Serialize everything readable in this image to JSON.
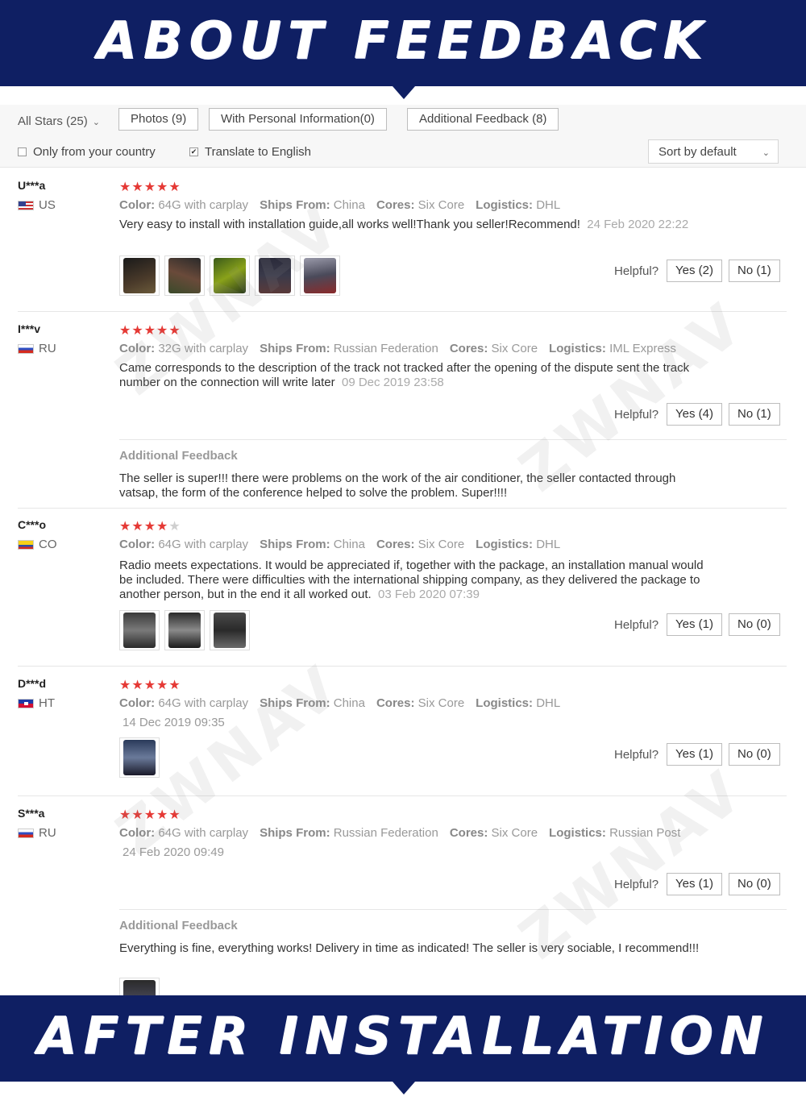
{
  "banners": {
    "top": "ABOUT FEEDBACK",
    "bottom": "AFTER INSTALLATION"
  },
  "filters": {
    "all_stars": "All Stars (25)",
    "photos": "Photos (9)",
    "personal_info": "With Personal Information(0)",
    "additional_feedback": "Additional Feedback (8)",
    "only_country": "Only from your country",
    "translate": "Translate to English",
    "translate_checked": true,
    "sort": "Sort by default"
  },
  "labels": {
    "color": "Color:",
    "ships_from": "Ships From:",
    "cores": "Cores:",
    "logistics": "Logistics:",
    "helpful": "Helpful?",
    "additional_feedback": "Additional Feedback"
  },
  "watermark": "ZWNAV",
  "reviews": [
    {
      "user": "U***a",
      "country": "US",
      "rating": 5,
      "color": "64G with carplay",
      "ships_from": "China",
      "cores": "Six Core",
      "logistics": "DHL",
      "text": "Very easy to install with installation guide,all works well!Thank you seller!Recommend!",
      "date": "24 Feb 2020 22:22",
      "yes": "Yes (2)",
      "no": "No (1)"
    },
    {
      "user": "I***v",
      "country": "RU",
      "rating": 5,
      "color": "32G with carplay",
      "ships_from": "Russian Federation",
      "cores": "Six Core",
      "logistics": "IML Express",
      "text": "Came corresponds to the description of the track not tracked after the opening of the dispute sent the track number on the connection will write later",
      "date": "09 Dec 2019 23:58",
      "yes": "Yes (4)",
      "no": "No (1)",
      "additional": "The seller is super!!! there were problems on the work of the air conditioner, the seller contacted through vatsap, the form of the conference helped to solve the problem. Super!!!!"
    },
    {
      "user": "C***o",
      "country": "CO",
      "rating": 4,
      "color": "64G with carplay",
      "ships_from": "China",
      "cores": "Six Core",
      "logistics": "DHL",
      "text": "Radio meets expectations. It would be appreciated if, together with the package, an installation manual would be included. There were difficulties with the international shipping company, as they delivered the package to another person, but in the end it all worked out.",
      "date": "03 Feb 2020 07:39",
      "yes": "Yes (1)",
      "no": "No (0)"
    },
    {
      "user": "D***d",
      "country": "HT",
      "rating": 5,
      "color": "64G with carplay",
      "ships_from": "China",
      "cores": "Six Core",
      "logistics": "DHL",
      "date": "14 Dec 2019 09:35",
      "yes": "Yes (1)",
      "no": "No (0)"
    },
    {
      "user": "S***a",
      "country": "RU",
      "rating": 5,
      "color": "64G with carplay",
      "ships_from": "Russian Federation",
      "cores": "Six Core",
      "logistics": "Russian Post",
      "date": "24 Feb 2020 09:49",
      "yes": "Yes (1)",
      "no": "No (0)",
      "additional": "Everything is fine, everything works! Delivery in time as indicated! The seller is very sociable, I recommend!!!"
    }
  ]
}
